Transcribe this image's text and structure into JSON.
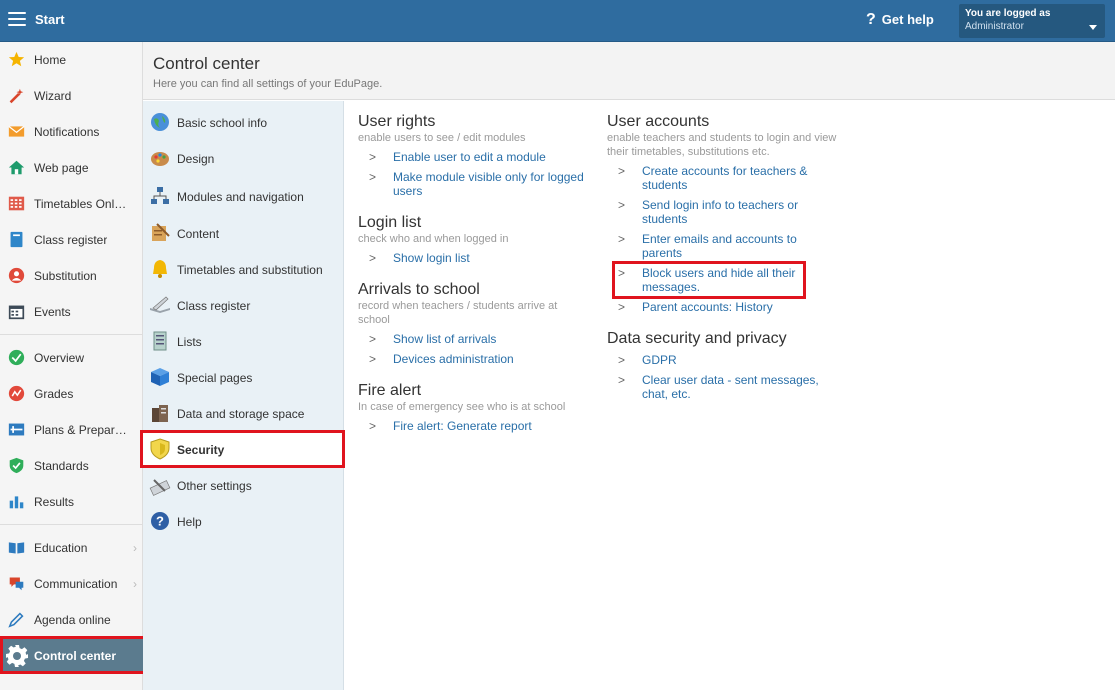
{
  "topbar": {
    "start_label": "Start",
    "help_label": "Get help",
    "login_line1": "You are logged as",
    "login_line2": "Administrator"
  },
  "leftnav": {
    "items": [
      {
        "label": "Home",
        "icon": "star-icon"
      },
      {
        "label": "Wizard",
        "icon": "wand-icon"
      },
      {
        "label": "Notifications",
        "icon": "envelope-icon"
      },
      {
        "label": "Web page",
        "icon": "house-icon"
      },
      {
        "label": "Timetables Onl…",
        "icon": "timetable-icon"
      },
      {
        "label": "Class register",
        "icon": "book-icon"
      },
      {
        "label": "Substitution",
        "icon": "person-icon"
      },
      {
        "label": "Events",
        "icon": "calendar-icon"
      },
      {
        "label": "Overview",
        "icon": "check-circle-icon"
      },
      {
        "label": "Grades",
        "icon": "grades-icon"
      },
      {
        "label": "Plans & Prepar…",
        "icon": "plans-icon"
      },
      {
        "label": "Standards",
        "icon": "shield-check-icon"
      },
      {
        "label": "Results",
        "icon": "bar-chart-icon"
      },
      {
        "label": "Education",
        "icon": "open-book-icon"
      },
      {
        "label": "Communication",
        "icon": "chat-icon"
      },
      {
        "label": "Agenda online",
        "icon": "pen-icon"
      },
      {
        "label": "Control center",
        "icon": "gear-icon"
      }
    ]
  },
  "header": {
    "title": "Control center",
    "subtitle": "Here you can find all settings of your EduPage."
  },
  "settings": {
    "items": [
      {
        "label": "Basic school info"
      },
      {
        "label": "Design"
      },
      {
        "label": "Modules and navigation"
      },
      {
        "label": "Content"
      },
      {
        "label": "Timetables and substitution"
      },
      {
        "label": "Class register"
      },
      {
        "label": "Lists"
      },
      {
        "label": "Special pages"
      },
      {
        "label": "Data and storage space"
      },
      {
        "label": "Security"
      },
      {
        "label": "Other settings"
      },
      {
        "label": "Help"
      }
    ]
  },
  "sections": {
    "user_rights": {
      "title": "User rights",
      "desc": "enable users to see / edit modules",
      "links": [
        "Enable user to edit a module",
        "Make module visible only for logged users"
      ]
    },
    "login_list": {
      "title": "Login list",
      "desc": "check who and when logged in",
      "links": [
        "Show login list"
      ]
    },
    "arrivals": {
      "title": "Arrivals to school",
      "desc": "record when teachers / students arrive at school",
      "links": [
        "Show list of arrivals",
        "Devices administration"
      ]
    },
    "fire_alert": {
      "title": "Fire alert",
      "desc": "In case of emergency see who is at school",
      "links": [
        "Fire alert: Generate report"
      ]
    },
    "user_accounts": {
      "title": "User accounts",
      "desc": "enable teachers and students to login and view their timetables, substitutions etc.",
      "links": [
        "Create accounts for teachers & students",
        "Send login info to teachers or students",
        "Enter emails and accounts to parents",
        "Block users and hide all their messages.",
        "Parent accounts: History"
      ]
    },
    "data_security": {
      "title": "Data security and privacy",
      "links": [
        "GDPR",
        "Clear user data - sent messages, chat, etc."
      ]
    }
  },
  "arrow_glyph": ">"
}
